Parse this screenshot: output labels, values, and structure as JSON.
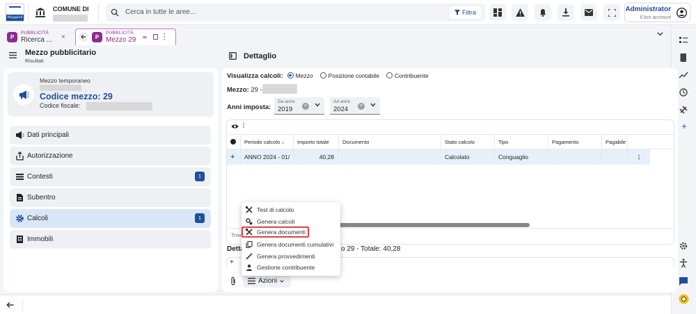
{
  "topbar": {
    "logo_text": "Maggioli",
    "comune_label": "COMUNE DI",
    "search_placeholder": "Cerca in tutte le aree...",
    "filter_label": "Filtra",
    "user_name": "Administrator",
    "user_sub": "Il tuo account"
  },
  "tabs": [
    {
      "badge": "P",
      "label": "PUBBLICITÀ",
      "value": "Ricerca ..."
    },
    {
      "badge": "P",
      "label": "PUBBLICITÀ",
      "value": "Mezzo 29"
    }
  ],
  "left": {
    "title": "Mezzo pubblicitario",
    "subtitle": "Risultati",
    "summary": {
      "type": "Mezzo temporaneo",
      "code": "Codice mezzo: 29",
      "fiscal_label": "Codice fiscale:"
    },
    "nav": [
      {
        "label": "Dati principali",
        "icon": "megaphone-icon"
      },
      {
        "label": "Autorizzazione",
        "icon": "file-upload-icon"
      },
      {
        "label": "Contesti",
        "icon": "list-icon",
        "badge": "1"
      },
      {
        "label": "Subentro",
        "icon": "document-icon"
      },
      {
        "label": "Calcoli",
        "icon": "gear-icon",
        "badge": "1",
        "active": true
      },
      {
        "label": "Immobili",
        "icon": "building-icon"
      }
    ]
  },
  "right": {
    "title": "Dettaglio",
    "visualizza_label": "Visualizza calcoli:",
    "radio_options": [
      "Mezzo",
      "Posizione contabile",
      "Contribuente"
    ],
    "selected_radio": "Mezzo",
    "mezzo_label": "Mezzo:",
    "mezzo_value": "29 -",
    "anni_label": "Anni imposta:",
    "da_anno_label": "Da anno",
    "da_anno_value": "2019",
    "ad_anno_label": "Ad anno",
    "ad_anno_value": "2024",
    "grid": {
      "columns": [
        "Periodo calcolo",
        "Importo totale",
        "Documento",
        "Stato calcolo",
        "Tipo",
        "Pagamento",
        "Pagabile"
      ],
      "row": {
        "periodo": "ANNO 2024 - 01/",
        "importo": "40,28",
        "documento": "",
        "stato": "Calcolato",
        "tipo": "Conguaglio",
        "pagamento": "",
        "pagabile": ""
      },
      "footer_text": "Trov"
    },
    "dettaglio_prefix": "Detta",
    "dettaglio_text": "o 29 - Totale: 40,28",
    "azioni_label": "Azioni"
  },
  "menu": [
    {
      "label": "Test di calcolo",
      "icon": "tools-icon"
    },
    {
      "label": "Genera calcoli",
      "icon": "gears-icon"
    },
    {
      "label": "Genera documenti",
      "icon": "tools-icon",
      "highlighted": true
    },
    {
      "label": "Genera documenti cumulativi",
      "icon": "copy-icon"
    },
    {
      "label": "Genera provvedimenti",
      "icon": "magic-wand-icon"
    },
    {
      "label": "Gestione contribuente",
      "icon": "person-icon"
    }
  ],
  "colors": {
    "primary": "#1d4f9c",
    "accent_tab": "#8d2a8d",
    "highlight": "#e04040"
  }
}
